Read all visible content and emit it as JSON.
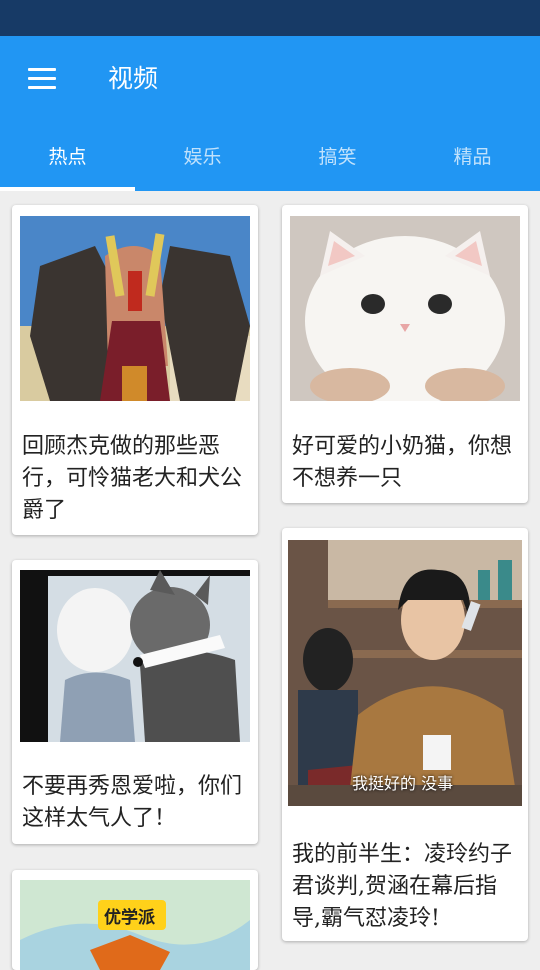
{
  "header": {
    "title": "视频",
    "tabs": [
      "热点",
      "娱乐",
      "搞笑",
      "精品"
    ],
    "active_tab": 0
  },
  "cards": [
    {
      "title": "回顾杰克做的那些恶行，可怜猫老大和犬公爵了"
    },
    {
      "title": "好可爱的小奶猫，你想不想养一只"
    },
    {
      "title": "不要再秀恩爱啦，你们这样太气人了！"
    },
    {
      "title": "我的前半生：凌玲约子君谈判,贺涵在幕后指导,霸气怼凌玲!",
      "caption": "我挺好的 没事"
    },
    {
      "badge": "优学派"
    }
  ],
  "colors": {
    "primary": "#2196f3",
    "status_bar": "#173a66"
  }
}
